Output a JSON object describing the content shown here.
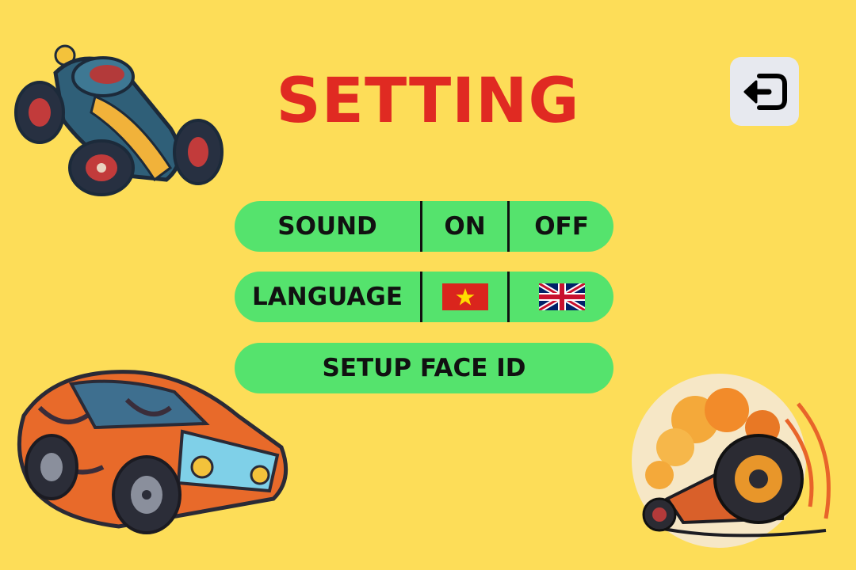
{
  "screen": {
    "title": "SETTING",
    "colors": {
      "background": "#FDDD58",
      "title": "#E02A22",
      "button": "#55E36D",
      "exit_button": "#E7E9EF"
    }
  },
  "exit_button": {
    "icon": "exit-icon"
  },
  "sound": {
    "label": "SOUND",
    "on_label": "ON",
    "off_label": "OFF"
  },
  "language": {
    "label": "LANGUAGE",
    "options": [
      {
        "icon": "vietnam-flag-icon"
      },
      {
        "icon": "uk-flag-icon"
      }
    ]
  },
  "face_id": {
    "label": "SETUP FACE ID"
  },
  "decorations": [
    "cartoon-kart-icon",
    "cartoon-muscle-car-icon",
    "cartoon-drift-car-icon"
  ]
}
